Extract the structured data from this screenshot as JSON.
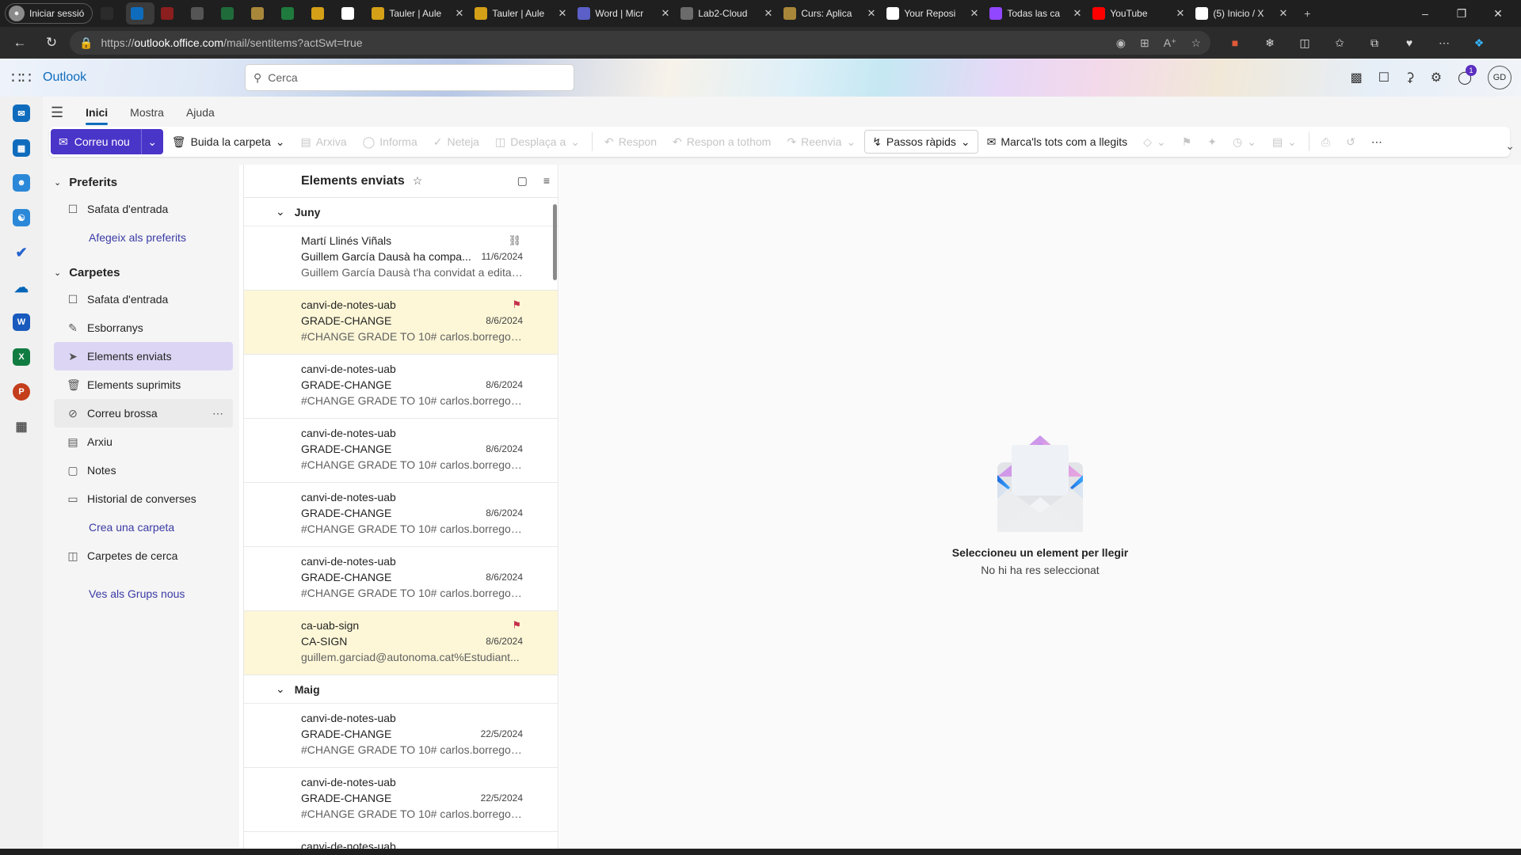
{
  "browser": {
    "profile_label": "Iniciar sessió",
    "tabs": [
      {
        "title": "",
        "icon": "pages-icon",
        "color": "#2b2b2b"
      },
      {
        "title": "",
        "icon": "outlook-favicon",
        "color": "#0f6cbd",
        "active": true
      },
      {
        "title": "",
        "icon": "pdf-favicon",
        "color": "#8b1e1e"
      },
      {
        "title": "",
        "icon": "tab-favicon",
        "color": "#555555"
      },
      {
        "title": "",
        "icon": "tab-favicon",
        "color": "#1f6b3a"
      },
      {
        "title": "",
        "icon": "aules-favicon",
        "color": "#a9873a"
      },
      {
        "title": "",
        "icon": "uab-favicon",
        "color": "#1f7a3e"
      },
      {
        "title": "",
        "icon": "aules-favicon",
        "color": "#d4a017"
      },
      {
        "title": "",
        "icon": "chatgpt-favicon",
        "color": "#ffffff"
      },
      {
        "title": "Tauler | Aule",
        "icon": "aules-favicon",
        "color": "#d4a017"
      },
      {
        "title": "Tauler | Aule",
        "icon": "aules-favicon",
        "color": "#d4a017"
      },
      {
        "title": "Word | Micr",
        "icon": "copilot-favicon",
        "color": "#5b5fc7"
      },
      {
        "title": "Lab2-Cloud",
        "icon": "doc-favicon",
        "color": "#6b6b6b"
      },
      {
        "title": "Curs: Aplica",
        "icon": "aules-favicon",
        "color": "#a9873a"
      },
      {
        "title": "Your Reposi",
        "icon": "github-favicon",
        "color": "#ffffff"
      },
      {
        "title": "Todas las ca",
        "icon": "twitch-favicon",
        "color": "#9146ff"
      },
      {
        "title": "YouTube",
        "icon": "youtube-favicon",
        "color": "#ff0000"
      },
      {
        "title": "(5) Inicio / X",
        "icon": "x-favicon",
        "color": "#ffffff"
      }
    ],
    "url_prefix": "https://",
    "url_host": "outlook.office.com",
    "url_path": "/mail/sentitems?actSwt=true"
  },
  "outlook": {
    "brand": "Outlook",
    "search_placeholder": "Cerca",
    "notification_count": "1",
    "user_initials": "GD"
  },
  "ribbon": {
    "tabs": [
      "Inici",
      "Mostra",
      "Ajuda"
    ],
    "new_mail": "Correu nou",
    "commands": {
      "empty_folder": "Buida la carpeta",
      "archive": "Arxiva",
      "report": "Informa",
      "sweep": "Neteja",
      "move": "Desplaça a",
      "reply": "Respon",
      "reply_all": "Respon a tothom",
      "forward": "Reenvia",
      "quick_steps": "Passos ràpids",
      "mark_all_read": "Marca'ls tots com a llegits"
    }
  },
  "folders": {
    "favorites_label": "Preferits",
    "favorites": [
      {
        "label": "Safata d'entrada",
        "icon": "inbox-icon"
      }
    ],
    "add_favorite": "Afegeix als preferits",
    "folders_label": "Carpetes",
    "items": [
      {
        "label": "Safata d'entrada",
        "icon": "inbox-icon"
      },
      {
        "label": "Esborranys",
        "icon": "draft-icon"
      },
      {
        "label": "Elements enviats",
        "icon": "send-icon",
        "selected": true
      },
      {
        "label": "Elements suprimits",
        "icon": "trash-icon"
      },
      {
        "label": "Correu brossa",
        "icon": "junk-icon",
        "hover": true
      },
      {
        "label": "Arxiu",
        "icon": "archive-icon"
      },
      {
        "label": "Notes",
        "icon": "note-icon"
      },
      {
        "label": "Historial de converses",
        "icon": "folder-icon"
      }
    ],
    "create_folder": "Crea una carpeta",
    "search_folders": "Carpetes de cerca",
    "new_groups": "Ves als Grups nous"
  },
  "list": {
    "title": "Elements enviats",
    "groups": [
      {
        "label": "Juny",
        "messages": [
          {
            "from": "Martí Llinés Viñals",
            "subject": "Guillem García Dausà ha compa...",
            "date": "11/6/2024",
            "preview": "Guillem García Dausà t'ha convidat a editar ...",
            "mark": "link"
          },
          {
            "from": "canvi-de-notes-uab",
            "subject": "GRADE-CHANGE",
            "date": "8/6/2024",
            "preview": "#CHANGE GRADE TO 10# carlos.borrego@...",
            "mark": "flag"
          },
          {
            "from": "canvi-de-notes-uab",
            "subject": "GRADE-CHANGE",
            "date": "8/6/2024",
            "preview": "#CHANGE GRADE TO 10# carlos.borrego@...",
            "mark": ""
          },
          {
            "from": "canvi-de-notes-uab",
            "subject": "GRADE-CHANGE",
            "date": "8/6/2024",
            "preview": "#CHANGE GRADE TO 10# carlos.borrego@...",
            "mark": ""
          },
          {
            "from": "canvi-de-notes-uab",
            "subject": "GRADE-CHANGE",
            "date": "8/6/2024",
            "preview": "#CHANGE GRADE TO 10# carlos.borrego@...",
            "mark": ""
          },
          {
            "from": "canvi-de-notes-uab",
            "subject": "GRADE-CHANGE",
            "date": "8/6/2024",
            "preview": "#CHANGE GRADE TO 10# carlos.borrego@...",
            "mark": ""
          },
          {
            "from": "ca-uab-sign",
            "subject": "CA-SIGN",
            "date": "8/6/2024",
            "preview": "guillem.garciad@autonoma.cat%Estudiant...",
            "mark": "flag"
          }
        ]
      },
      {
        "label": "Maig",
        "messages": [
          {
            "from": "canvi-de-notes-uab",
            "subject": "GRADE-CHANGE",
            "date": "22/5/2024",
            "preview": "#CHANGE GRADE TO 10# carlos.borrego@...",
            "mark": ""
          },
          {
            "from": "canvi-de-notes-uab",
            "subject": "GRADE-CHANGE",
            "date": "22/5/2024",
            "preview": "#CHANGE GRADE TO 10# carlos.borrego@...",
            "mark": ""
          },
          {
            "from": "canvi-de-notes-uab",
            "subject": "",
            "date": "",
            "preview": "",
            "mark": ""
          }
        ]
      }
    ]
  },
  "reading": {
    "heading": "Seleccioneu un element per llegir",
    "sub": "No hi ha res seleccionat"
  },
  "colors": {
    "accent": "#0f6cbd",
    "new_mail": "#4a35c9",
    "flagged_bg": "#fdf7d7",
    "flag": "#c4314b",
    "selected_folder": "#dcd6f4"
  }
}
